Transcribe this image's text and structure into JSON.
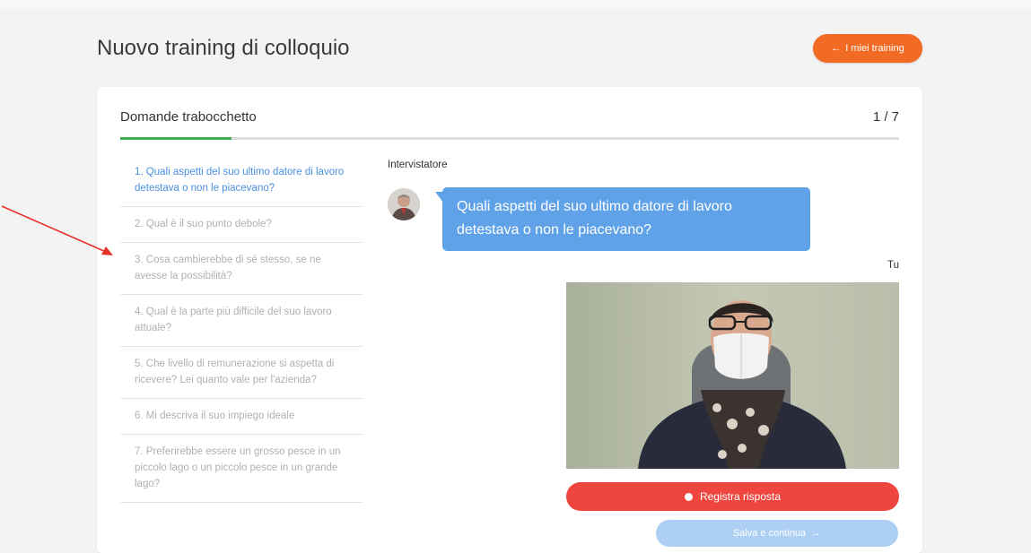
{
  "header": {
    "title": "Nuovo training di colloquio",
    "back_button_arrow": "←",
    "back_button_label": "I miei training"
  },
  "section": {
    "title": "Domande trabocchetto",
    "counter": "1 / 7",
    "progress_fraction": 0.143,
    "progress_color": "#3fae4a"
  },
  "questions": [
    {
      "text": "1. Quali aspetti del suo ultimo datore di lavoro detestava o non le piacevano?",
      "active": true
    },
    {
      "text": "2. Qual è il suo punto debole?",
      "active": false
    },
    {
      "text": "3. Cosa cambierebbe di sé stesso, se ne avesse la possibilità?",
      "active": false
    },
    {
      "text": "4. Qual è la parte più difficile del suo lavoro attuale?",
      "active": false
    },
    {
      "text": "5. Che livello di remunerazione si aspetta di ricevere? Lei quanto vale per l'azienda?",
      "active": false
    },
    {
      "text": "6. Mi descriva il suo impiego ideale",
      "active": false
    },
    {
      "text": "7. Preferirebbe essere un grosso pesce in un piccolo lago o un piccolo pesce in un grande lago?",
      "active": false
    }
  ],
  "chat": {
    "interviewer_label": "Intervistatore",
    "interviewer_message": "Quali aspetti del suo ultimo datore di lavoro detestava o non le piacevano?",
    "user_label": "Tu"
  },
  "actions": {
    "record_label": "Registra risposta",
    "save_label": "Salva e continua",
    "save_arrow": "→"
  },
  "colors": {
    "accent_orange": "#f26b24",
    "bubble_blue": "#5fa2e8",
    "record_red": "#ee453f",
    "save_disabled_blue": "#aecff4",
    "active_question_blue": "#4a90e2",
    "annotation_arrow_red": "#e8332a"
  },
  "icons": {
    "back": "arrow-left-icon",
    "record": "record-dot-icon",
    "save": "arrow-right-icon"
  }
}
